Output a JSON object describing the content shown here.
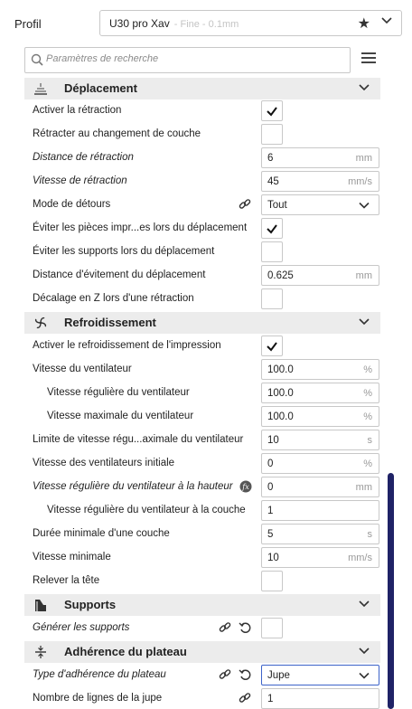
{
  "profile": {
    "label": "Profil",
    "name": "U30 pro Xav",
    "sub": " - Fine - 0.1mm"
  },
  "search": {
    "placeholder": "Paramètres de recherche"
  },
  "sections": {
    "travel": {
      "title": "Déplacement",
      "rows": {
        "retraction": "Activer la rétraction",
        "retract_layer": "Rétracter au changement de couche",
        "retract_distance": {
          "label": "Distance de rétraction",
          "value": "6",
          "unit": "mm"
        },
        "retract_speed": {
          "label": "Vitesse de rétraction",
          "value": "45",
          "unit": "mm/s"
        },
        "combing": {
          "label": "Mode de détours",
          "value": "Tout"
        },
        "avoid_parts": "Éviter les pièces impr...es lors du déplacement",
        "avoid_supports": "Éviter les supports lors du déplacement",
        "avoid_distance": {
          "label": "Distance d'évitement du déplacement",
          "value": "0.625",
          "unit": "mm"
        },
        "z_hop": "Décalage en Z lors d'une rétraction"
      }
    },
    "cooling": {
      "title": "Refroidissement",
      "rows": {
        "enable_cooling": "Activer le refroidissement de l'impression",
        "fan_speed": {
          "label": "Vitesse du ventilateur",
          "value": "100.0",
          "unit": "%"
        },
        "fan_regular": {
          "label": "Vitesse régulière du ventilateur",
          "value": "100.0",
          "unit": "%"
        },
        "fan_max": {
          "label": "Vitesse maximale du ventilateur",
          "value": "100.0",
          "unit": "%"
        },
        "fan_threshold": {
          "label": "Limite de vitesse régu...aximale du ventilateur",
          "value": "10",
          "unit": "s"
        },
        "fan_initial": {
          "label": "Vitesse des ventilateurs initiale",
          "value": "0",
          "unit": "%"
        },
        "fan_height": {
          "label": "Vitesse régulière du ventilateur à la hauteur",
          "value": "0",
          "unit": "mm"
        },
        "fan_layer": {
          "label": "Vitesse régulière du ventilateur à la couche",
          "value": "1"
        },
        "min_layer_time": {
          "label": "Durée minimale d'une couche",
          "value": "5",
          "unit": "s"
        },
        "min_speed": {
          "label": "Vitesse minimale",
          "value": "10",
          "unit": "mm/s"
        },
        "lift_head": "Relever la tête"
      }
    },
    "supports": {
      "title": "Supports",
      "rows": {
        "generate": "Générer les supports"
      }
    },
    "adhesion": {
      "title": "Adhérence du plateau",
      "rows": {
        "type": {
          "label": "Type d'adhérence du plateau",
          "value": "Jupe"
        },
        "skirt_lines": {
          "label": "Nombre de lignes de la jupe",
          "value": "1"
        }
      }
    }
  },
  "colors": {
    "accent": "#3d63c9",
    "scrollbar": "#1f2266",
    "section_bg": "#ececec"
  }
}
